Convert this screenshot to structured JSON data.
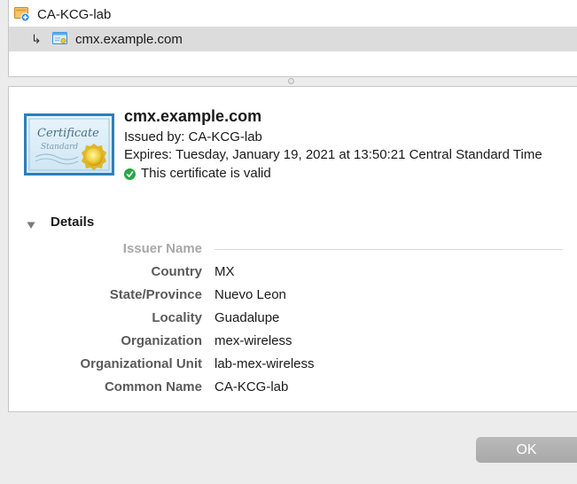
{
  "chain": {
    "root": {
      "name": "CA-KCG-lab",
      "icon": "root-certificate-icon"
    },
    "leaf": {
      "arrow": "↳",
      "name": "cmx.example.com",
      "icon": "certificate-icon"
    }
  },
  "certificate": {
    "image_text": "Certificate",
    "image_subtext": "Standard",
    "common_name": "cmx.example.com",
    "issued_by": "Issued by: CA-KCG-lab",
    "expires": "Expires: Tuesday, January 19, 2021 at 13:50:21 Central Standard Time",
    "validity": "This certificate is valid",
    "validity_color": "#28a745"
  },
  "details": {
    "header": "Details",
    "section_label": "Issuer Name",
    "fields": [
      {
        "label": "Country",
        "value": "MX"
      },
      {
        "label": "State/Province",
        "value": "Nuevo Leon"
      },
      {
        "label": "Locality",
        "value": "Guadalupe"
      },
      {
        "label": "Organization",
        "value": "mex-wireless"
      },
      {
        "label": "Organizational Unit",
        "value": "lab-mex-wireless"
      },
      {
        "label": "Common Name",
        "value": "CA-KCG-lab"
      }
    ]
  },
  "buttons": {
    "ok": "OK"
  }
}
